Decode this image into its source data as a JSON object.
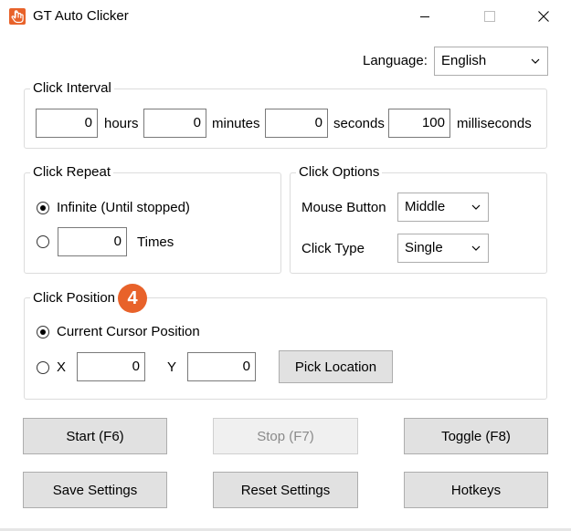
{
  "window": {
    "title": "GT Auto Clicker"
  },
  "language": {
    "label": "Language:",
    "value": "English"
  },
  "click_interval": {
    "legend": "Click Interval",
    "hours": {
      "value": "0",
      "unit": "hours"
    },
    "minutes": {
      "value": "0",
      "unit": "minutes"
    },
    "seconds": {
      "value": "0",
      "unit": "seconds"
    },
    "milliseconds": {
      "value": "100",
      "unit": "milliseconds"
    }
  },
  "click_repeat": {
    "legend": "Click Repeat",
    "infinite_label": "Infinite (Until stopped)",
    "times_value": "0",
    "times_label": "Times",
    "selected": "infinite"
  },
  "click_options": {
    "legend": "Click Options",
    "mouse_button_label": "Mouse Button",
    "mouse_button_value": "Middle",
    "click_type_label": "Click Type",
    "click_type_value": "Single"
  },
  "click_position": {
    "legend": "Click Position",
    "badge": "4",
    "current_cursor_label": "Current Cursor Position",
    "x_label": "X",
    "x_value": "0",
    "y_label": "Y",
    "y_value": "0",
    "pick_location_label": "Pick Location",
    "selected": "current"
  },
  "buttons": {
    "start": "Start (F6)",
    "stop": "Stop (F7)",
    "toggle": "Toggle (F8)",
    "save_settings": "Save Settings",
    "reset_settings": "Reset Settings",
    "hotkeys": "Hotkeys"
  },
  "colors": {
    "accent": "#e8622a",
    "button_bg": "#e1e1e1",
    "group_border": "#dcdcdc"
  }
}
